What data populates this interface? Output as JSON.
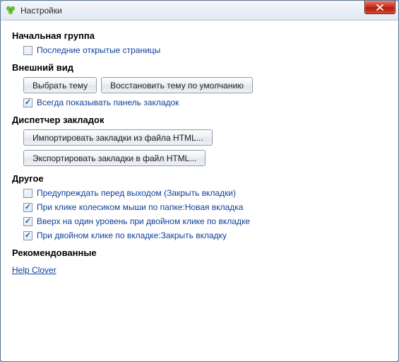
{
  "window": {
    "title": "Настройки"
  },
  "sections": {
    "startup_group": {
      "title": "Начальная группа",
      "last_open_pages": {
        "label": "Последние открытые страницы",
        "checked": false
      }
    },
    "appearance": {
      "title": "Внешний вид",
      "choose_theme_btn": "Выбрать тему",
      "reset_theme_btn": "Восстановить тему по умолчанию",
      "always_show_bookmarks": {
        "label": "Всегда показывать панель закладок",
        "checked": true
      }
    },
    "bookmarks_manager": {
      "title": "Диспетчер закладок",
      "import_btn": "Импортировать закладки из файла HTML...",
      "export_btn": "Экспортировать закладки в файл HTML..."
    },
    "other": {
      "title": "Другое",
      "warn_before_exit": {
        "label": "Предупреждать перед выходом (Закрыть вкладки)",
        "checked": false
      },
      "wheel_click_folder": {
        "label": "При клике колесиком мыши по папке:Новая вкладка",
        "checked": true
      },
      "double_click_up": {
        "label": "Вверх на один уровень при двойном клике по вкладке",
        "checked": true
      },
      "double_click_close": {
        "label": "При двойном клике по вкладке:Закрыть вкладку",
        "checked": true
      }
    },
    "recommended": {
      "title": "Рекомендованные",
      "help_link": "Help Clover"
    }
  }
}
